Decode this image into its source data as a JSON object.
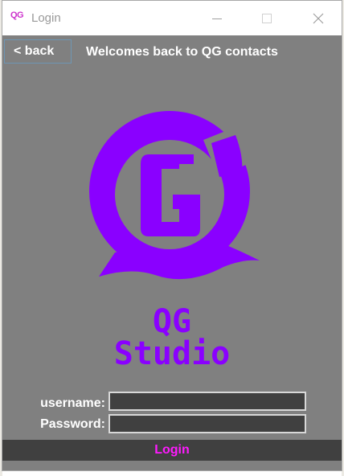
{
  "window": {
    "icon_text": "QG",
    "title": "Login"
  },
  "header": {
    "back_label": "< back",
    "title": "Welcomes back to QG contacts"
  },
  "logo": {
    "icon": "qg-logo-icon",
    "text": "QG Studio",
    "color": "#8a00ff"
  },
  "form": {
    "username_label": "username:",
    "username_value": "",
    "password_label": "Password:",
    "password_value": "",
    "login_label": "Login"
  },
  "colors": {
    "client_bg": "#808080",
    "input_bg": "#404040",
    "login_text": "#ff1aff"
  }
}
